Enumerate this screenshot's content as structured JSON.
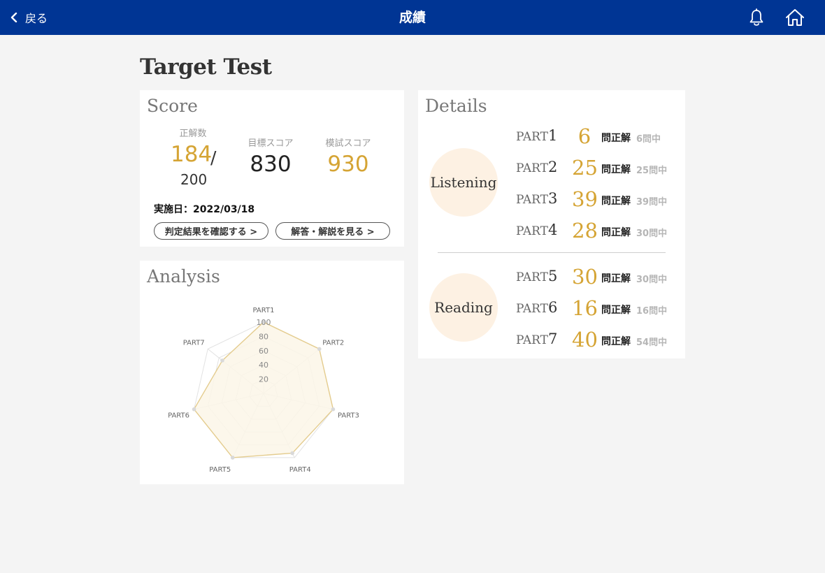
{
  "header": {
    "back_label": "戻る",
    "title": "成績",
    "bg_color": "#003594",
    "icons": [
      "chevron-left-icon",
      "bell-icon",
      "home-icon"
    ]
  },
  "page": {
    "title": "Target Test"
  },
  "score": {
    "title": "Score",
    "correct_label": "正解数",
    "correct_value": "184",
    "correct_total": "200",
    "target_label": "目標スコア",
    "target_value": "830",
    "mock_label": "模試スコア",
    "mock_value": "930",
    "date_text": "実施日：2022/03/18",
    "judgement_button": "判定結果を確認する >",
    "answers_button": "解答・解説を見る >"
  },
  "analysis": {
    "title": "Analysis"
  },
  "chart_data": {
    "type": "radar",
    "categories": [
      "PART1",
      "PART2",
      "PART3",
      "PART4",
      "PART5",
      "PART6",
      "PART7"
    ],
    "series": [
      {
        "values": [
          100,
          100,
          100,
          93,
          100,
          100,
          74
        ]
      }
    ],
    "ticks": [
      "20",
      "40",
      "60",
      "80",
      "100"
    ],
    "range": [
      0,
      100
    ],
    "fill_color": "#fbf6e8",
    "line_color": "#e4cc8e",
    "grid_color": "#e2e2e2"
  },
  "details": {
    "title": "Details",
    "sections": [
      {
        "name": "Listening",
        "parts": [
          {
            "label": "PART",
            "num": "1",
            "correct": "6",
            "unit": "問正解",
            "of": "6問中"
          },
          {
            "label": "PART",
            "num": "2",
            "correct": "25",
            "unit": "問正解",
            "of": "25問中"
          },
          {
            "label": "PART",
            "num": "3",
            "correct": "39",
            "unit": "問正解",
            "of": "39問中"
          },
          {
            "label": "PART",
            "num": "4",
            "correct": "28",
            "unit": "問正解",
            "of": "30問中"
          }
        ]
      },
      {
        "name": "Reading",
        "parts": [
          {
            "label": "PART",
            "num": "5",
            "correct": "30",
            "unit": "問正解",
            "of": "30問中"
          },
          {
            "label": "PART",
            "num": "6",
            "correct": "16",
            "unit": "問正解",
            "of": "16問中"
          },
          {
            "label": "PART",
            "num": "7",
            "correct": "40",
            "unit": "問正解",
            "of": "54問中"
          }
        ]
      }
    ]
  },
  "colors": {
    "accent_gold": "#d5a434",
    "circle_bg": "#fdf1e3",
    "page_bg": "#f4f4f4"
  }
}
